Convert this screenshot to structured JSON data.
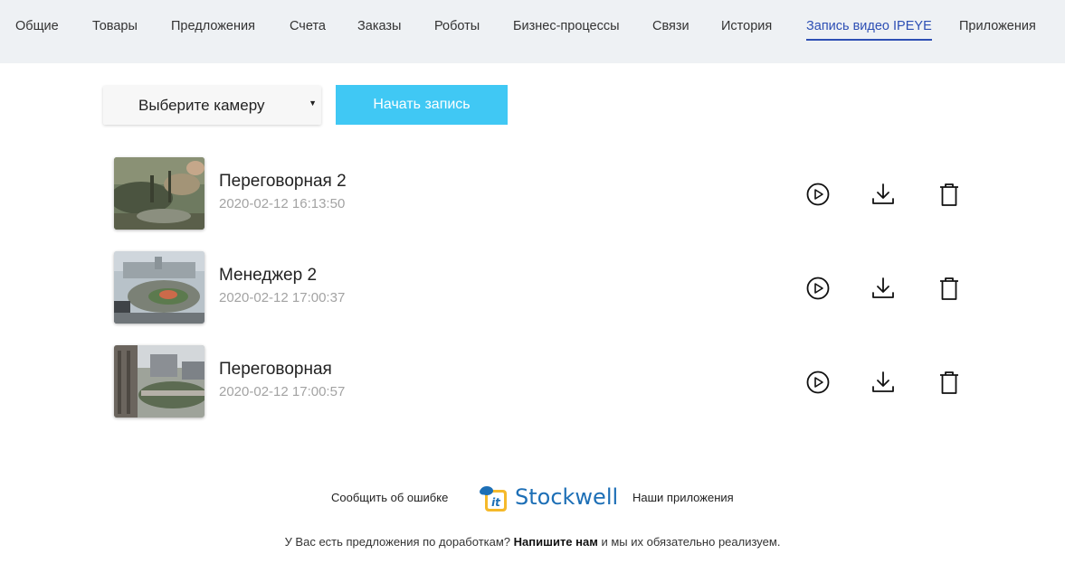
{
  "tabs": [
    {
      "label": "Общие"
    },
    {
      "label": "Товары"
    },
    {
      "label": "Предложения"
    },
    {
      "label": "Счета"
    },
    {
      "label": "Заказы"
    },
    {
      "label": "Роботы"
    },
    {
      "label": "Бизнес-процессы"
    },
    {
      "label": "Связи"
    },
    {
      "label": "История"
    },
    {
      "label": "Запись видео IPEYE",
      "active": true
    },
    {
      "label": "Приложения"
    }
  ],
  "camera_select": {
    "value": "Выберите камеру",
    "arrow_icon": "caret-down-icon"
  },
  "record_button": {
    "label": "Начать запись"
  },
  "recordings": [
    {
      "name": "Переговорная 2",
      "date": "2020-02-12 16:13:50"
    },
    {
      "name": "Менеджер 2",
      "date": "2020-02-12 17:00:37"
    },
    {
      "name": "Переговорная",
      "date": "2020-02-12 17:00:57"
    }
  ],
  "actions": {
    "play_icon": "play-circle-icon",
    "download_icon": "download-icon",
    "delete_icon": "trash-icon"
  },
  "footer": {
    "report_error": "Сообщить об ошибке",
    "logo_text": "Stockwell",
    "logo_badge": "it",
    "our_apps": "Наши приложения",
    "suggest_before": "У Вас есть предложения по доработкам?",
    "suggest_link": "Напишите нам",
    "suggest_after": "и мы их обязательно реализуем."
  },
  "colors": {
    "accent": "#40c8f4",
    "active_tab": "#2d4fb4",
    "tab_bar": "#eef1f4",
    "logo_blue": "#1d6fb6",
    "logo_yellow": "#f5b92a"
  }
}
